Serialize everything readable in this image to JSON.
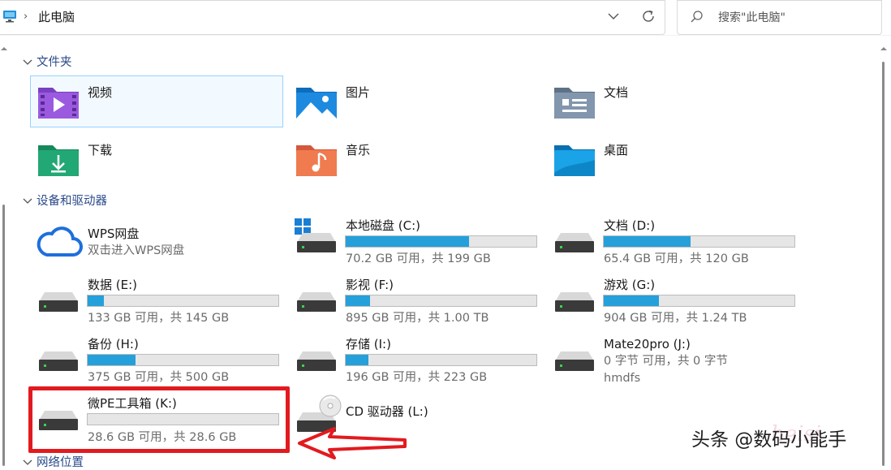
{
  "addressbar": {
    "path": "此电脑"
  },
  "search": {
    "placeholder": "搜索\"此电脑\""
  },
  "sections": {
    "folders": "文件夹",
    "devices": "设备和驱动器",
    "network": "网络位置"
  },
  "folders": [
    {
      "label": "视频",
      "icon": "video-folder-icon"
    },
    {
      "label": "图片",
      "icon": "pictures-folder-icon"
    },
    {
      "label": "文档",
      "icon": "documents-folder-icon"
    },
    {
      "label": "下载",
      "icon": "downloads-folder-icon"
    },
    {
      "label": "音乐",
      "icon": "music-folder-icon"
    },
    {
      "label": "桌面",
      "icon": "desktop-folder-icon"
    }
  ],
  "wps": {
    "name": "WPS网盘",
    "sub": "双击进入WPS网盘"
  },
  "drives": [
    {
      "name": "本地磁盘 (C:)",
      "info": "70.2 GB 可用，共 199 GB",
      "used": 0.647
    },
    {
      "name": "文档 (D:)",
      "info": "65.4 GB 可用，共 120 GB",
      "used": 0.455
    },
    {
      "name": "数据 (E:)",
      "info": "133 GB 可用，共 145 GB",
      "used": 0.083
    },
    {
      "name": "影视 (F:)",
      "info": "895 GB 可用，共 1.00 TB",
      "used": 0.126
    },
    {
      "name": "游戏 (G:)",
      "info": "904 GB 可用，共 1.24 TB",
      "used": 0.288
    },
    {
      "name": "备份 (H:)",
      "info": "375 GB 可用，共 500 GB",
      "used": 0.25
    },
    {
      "name": "存储 (I:)",
      "info": "196 GB 可用，共 223 GB",
      "used": 0.121
    },
    {
      "name": "微PE工具箱 (K:)",
      "info": "28.6 GB 可用，共 28.6 GB",
      "used": 0.0
    }
  ],
  "mate": {
    "name": "Mate20pro (J:)",
    "info": "0 字节 可用，共 0 字节",
    "fs": "hmdfs"
  },
  "cd": {
    "name": "CD 驱动器 (L:)"
  },
  "watermark": {
    "text": "头条 @数码小能手",
    "faint": "heisi"
  },
  "colors": {
    "accent": "#26a0da",
    "highlight": "#e21a1f"
  }
}
